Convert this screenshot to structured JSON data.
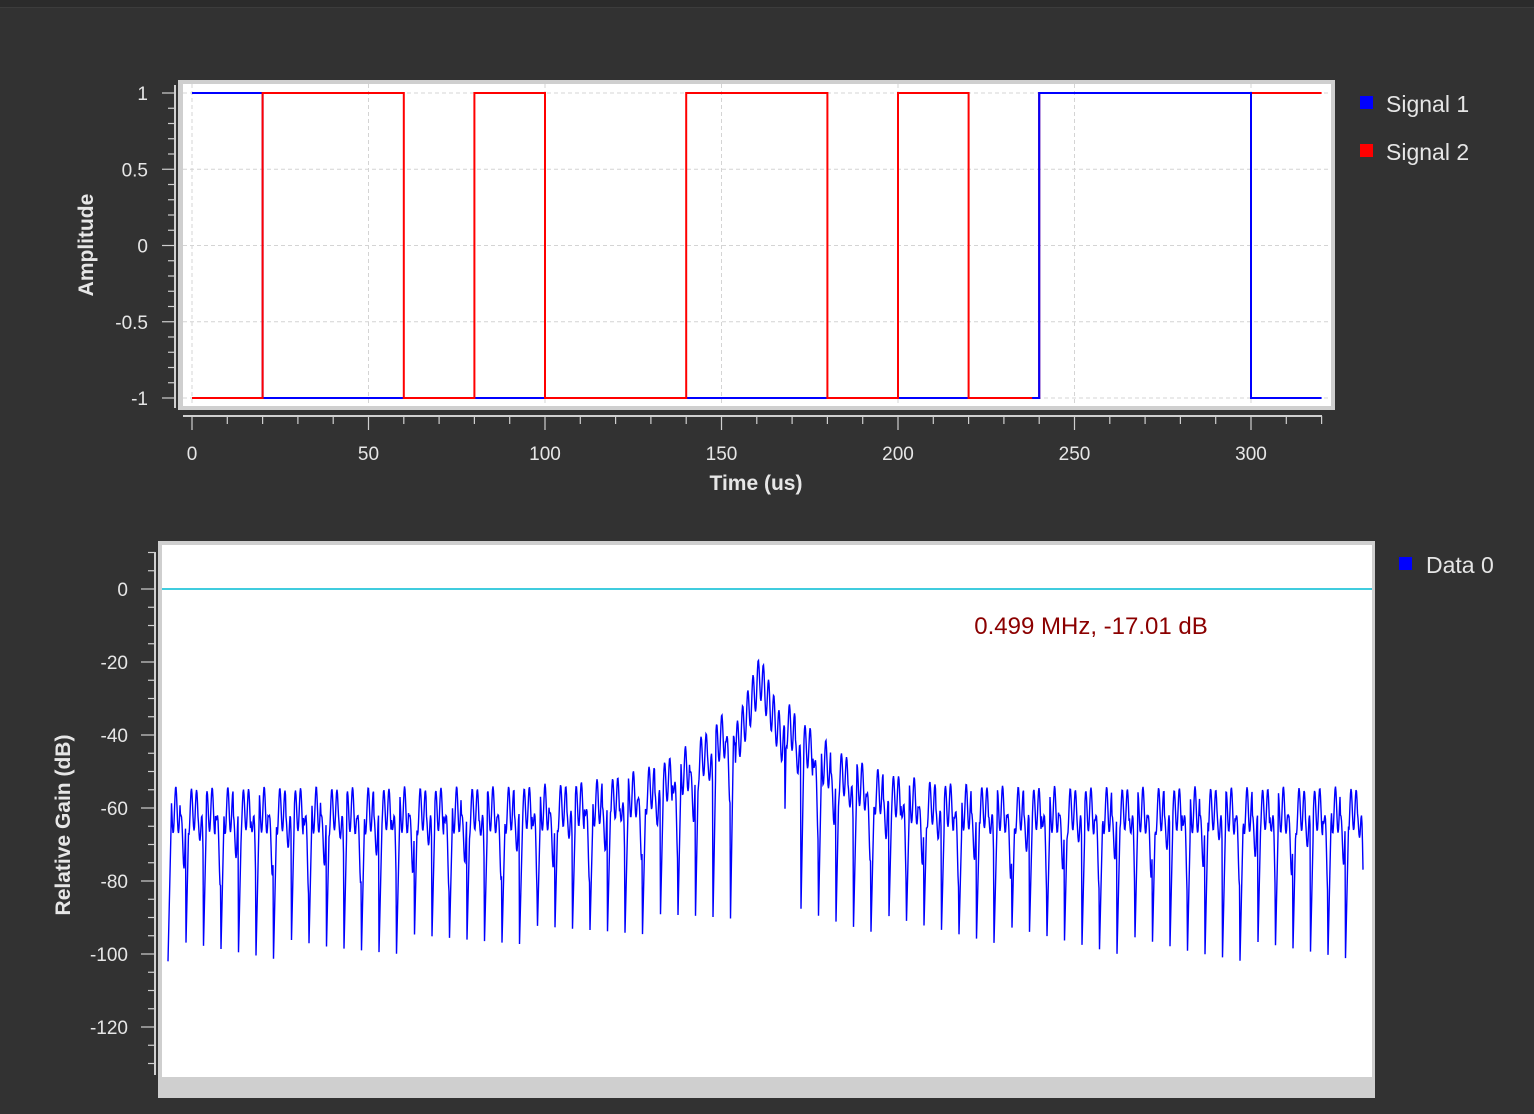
{
  "colors": {
    "background": "#323232",
    "plot_bg": "#ffffff",
    "signal1": "#0000ff",
    "signal2": "#ff0000",
    "data0": "#0000ff",
    "ref_line": "#00bcd4",
    "marker_text": "#8b0000",
    "axis_text": "#e6e6e6"
  },
  "chart_data": [
    {
      "type": "line",
      "title": "",
      "xlabel": "Time (us)",
      "ylabel": "Amplitude",
      "xlim": [
        -3,
        320
      ],
      "ylim": [
        -1.05,
        1.05
      ],
      "xticks": [
        0,
        50,
        100,
        150,
        200,
        250,
        300
      ],
      "xtick_labels": [
        "0",
        "50",
        "100",
        "150",
        "200",
        "250",
        "300"
      ],
      "yticks": [
        1,
        0.5,
        0,
        -0.5,
        -1
      ],
      "ytick_labels": [
        "1",
        "0.5",
        "0",
        "-0.5",
        "-1"
      ],
      "grid": true,
      "legend": "right",
      "series": [
        {
          "name": "Signal 1",
          "color": "#0000ff",
          "x": [
            0,
            20,
            20,
            240,
            240,
            300,
            300,
            320
          ],
          "y": [
            1,
            1,
            -1,
            -1,
            1,
            1,
            -1,
            -1
          ]
        },
        {
          "name": "Signal 2",
          "color": "#ff0000",
          "x": [
            0,
            20,
            20,
            60,
            60,
            80,
            80,
            100,
            100,
            140,
            140,
            180,
            180,
            200,
            200,
            220,
            220,
            240,
            240,
            320
          ],
          "y": [
            -1,
            -1,
            1,
            1,
            -1,
            -1,
            1,
            1,
            -1,
            -1,
            1,
            1,
            -1,
            -1,
            1,
            1,
            -1,
            -1,
            1,
            1
          ]
        }
      ]
    },
    {
      "type": "line",
      "title": "",
      "xlabel": "",
      "ylabel": "Relative Gain (dB)",
      "ylim": [
        -132,
        10
      ],
      "yticks": [
        0,
        -20,
        -40,
        -60,
        -80,
        -100,
        -120
      ],
      "ytick_labels": [
        "0",
        "-20",
        "-40",
        "-60",
        "-80",
        "-100",
        "-120"
      ],
      "grid": false,
      "legend": "right",
      "reference_line_db": 0,
      "marker_label": "0.499 MHz, -17.01 dB",
      "spectrum_model": {
        "lobes": 68,
        "peak_db": -18,
        "edge_top_db": -54,
        "floor_near_center_db": -92,
        "floor_edge_db": -102
      },
      "series": [
        {
          "name": "Data 0",
          "color": "#0000ff"
        }
      ]
    }
  ]
}
